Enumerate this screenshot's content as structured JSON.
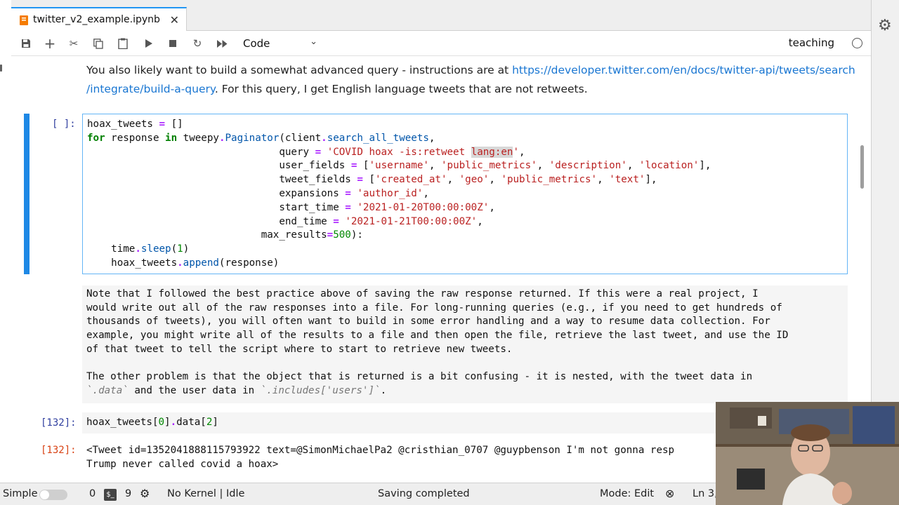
{
  "tab": {
    "title": "twitter_v2_example.ipynb",
    "close_symbol": "✕"
  },
  "toolbar": {
    "cell_type": "Code",
    "kernel_name": "teaching",
    "icons": [
      "save-icon",
      "add-icon",
      "cut-icon",
      "copy-icon",
      "paste-icon",
      "run-icon",
      "stop-icon",
      "restart-icon",
      "fast-forward-icon"
    ]
  },
  "markdown_top": {
    "line1_text": "You also likely want to build a somewhat advanced query - instructions are at ",
    "line1_link": "https://developer.twitter.com/en/docs/twitter-api/tweets/search",
    "line2_link": "/integrate/build-a-query",
    "line2_text": ". For this query, I get English language tweets that are not retweets."
  },
  "code_cell": {
    "prompt": "[ ]:",
    "lines": [
      {
        "parts": [
          [
            "t",
            "hoax_tweets "
          ],
          [
            "op",
            "="
          ],
          [
            "t",
            " []"
          ]
        ]
      },
      {
        "parts": [
          [
            "kw",
            "for"
          ],
          [
            "t",
            " response "
          ],
          [
            "kw",
            "in"
          ],
          [
            "t",
            " tweepy"
          ],
          [
            "op",
            "."
          ],
          [
            "fn",
            "Paginator"
          ],
          [
            "t",
            "(client"
          ],
          [
            "op",
            "."
          ],
          [
            "fn",
            "search_all_tweets"
          ],
          [
            "t",
            ","
          ]
        ]
      },
      {
        "parts": [
          [
            "t",
            "                                query "
          ],
          [
            "op",
            "="
          ],
          [
            "t",
            " "
          ],
          [
            "str",
            "'COVID hoax -is:retweet "
          ],
          [
            "hl",
            "lang:en"
          ],
          [
            "str",
            "'"
          ],
          [
            "t",
            ","
          ]
        ]
      },
      {
        "parts": [
          [
            "t",
            "                                user_fields "
          ],
          [
            "op",
            "="
          ],
          [
            "t",
            " ["
          ],
          [
            "str",
            "'username'"
          ],
          [
            "t",
            ", "
          ],
          [
            "str",
            "'public_metrics'"
          ],
          [
            "t",
            ", "
          ],
          [
            "str",
            "'description'"
          ],
          [
            "t",
            ", "
          ],
          [
            "str",
            "'location'"
          ],
          [
            "t",
            "],"
          ]
        ]
      },
      {
        "parts": [
          [
            "t",
            "                                tweet_fields "
          ],
          [
            "op",
            "="
          ],
          [
            "t",
            " ["
          ],
          [
            "str",
            "'created_at'"
          ],
          [
            "t",
            ", "
          ],
          [
            "str",
            "'geo'"
          ],
          [
            "t",
            ", "
          ],
          [
            "str",
            "'public_metrics'"
          ],
          [
            "t",
            ", "
          ],
          [
            "str",
            "'text'"
          ],
          [
            "t",
            "],"
          ]
        ]
      },
      {
        "parts": [
          [
            "t",
            "                                expansions "
          ],
          [
            "op",
            "="
          ],
          [
            "t",
            " "
          ],
          [
            "str",
            "'author_id'"
          ],
          [
            "t",
            ","
          ]
        ]
      },
      {
        "parts": [
          [
            "t",
            "                                start_time "
          ],
          [
            "op",
            "="
          ],
          [
            "t",
            " "
          ],
          [
            "str",
            "'2021-01-20T00:00:00Z'"
          ],
          [
            "t",
            ","
          ]
        ]
      },
      {
        "parts": [
          [
            "t",
            "                                end_time "
          ],
          [
            "op",
            "="
          ],
          [
            "t",
            " "
          ],
          [
            "str",
            "'2021-01-21T00:00:00Z'"
          ],
          [
            "t",
            ","
          ]
        ]
      },
      {
        "parts": [
          [
            "t",
            "                             max_results"
          ],
          [
            "op",
            "="
          ],
          [
            "num",
            "500"
          ],
          [
            "t",
            "):"
          ]
        ]
      },
      {
        "parts": [
          [
            "t",
            "    time"
          ],
          [
            "op",
            "."
          ],
          [
            "fn",
            "sleep"
          ],
          [
            "t",
            "("
          ],
          [
            "num",
            "1"
          ],
          [
            "t",
            ")"
          ]
        ]
      },
      {
        "parts": [
          [
            "t",
            "    hoax_tweets"
          ],
          [
            "op",
            "."
          ],
          [
            "fn",
            "append"
          ],
          [
            "t",
            "(response)"
          ]
        ]
      }
    ]
  },
  "markdown_cell": {
    "lines": [
      "Note that I followed the best practice above of saving the raw response returned. If this were a real project, I",
      "would write out all of the raw responses into a file. For long-running queries (e.g., if you need to get hundreds of",
      "thousands of tweets), you will often want to build in some error handling and a way to resume data collection. For",
      "example, you might write all of the results to a file and then open the file, retrieve the last tweet, and use the ID",
      "of that tweet to tell the script where to start to retrieve new tweets.",
      "",
      "The other problem is that the object that is returned is a bit confusing - it is nested, with the tweet data in"
    ],
    "last_line": {
      "a": "`.data`",
      "b": " and the user data in ",
      "c": "`.includes['users']`",
      "d": "."
    }
  },
  "code_cell2": {
    "prompt": "[132]:",
    "parts": [
      [
        "t",
        "hoax_tweets["
      ],
      [
        "num",
        "0"
      ],
      [
        "t",
        "]"
      ],
      [
        "op",
        "."
      ],
      [
        "t",
        "data["
      ],
      [
        "num",
        "2"
      ],
      [
        "t",
        "]"
      ]
    ]
  },
  "output_cell": {
    "prompt": "[132]:",
    "line1": "<Tweet id=1352041888115793922 text=@SimonMichaelPa2 @cristhian_0707 @guypbenson I'm not gonna resp",
    "line2": "Trump never called covid a hoax>"
  },
  "statusbar": {
    "mode_label": "Simple",
    "count_a": "0",
    "count_b": "9",
    "kernel_status": "No Kernel | Idle",
    "save_status": "Saving completed",
    "mode": "Mode: Edit",
    "position": "Ln 3,"
  }
}
